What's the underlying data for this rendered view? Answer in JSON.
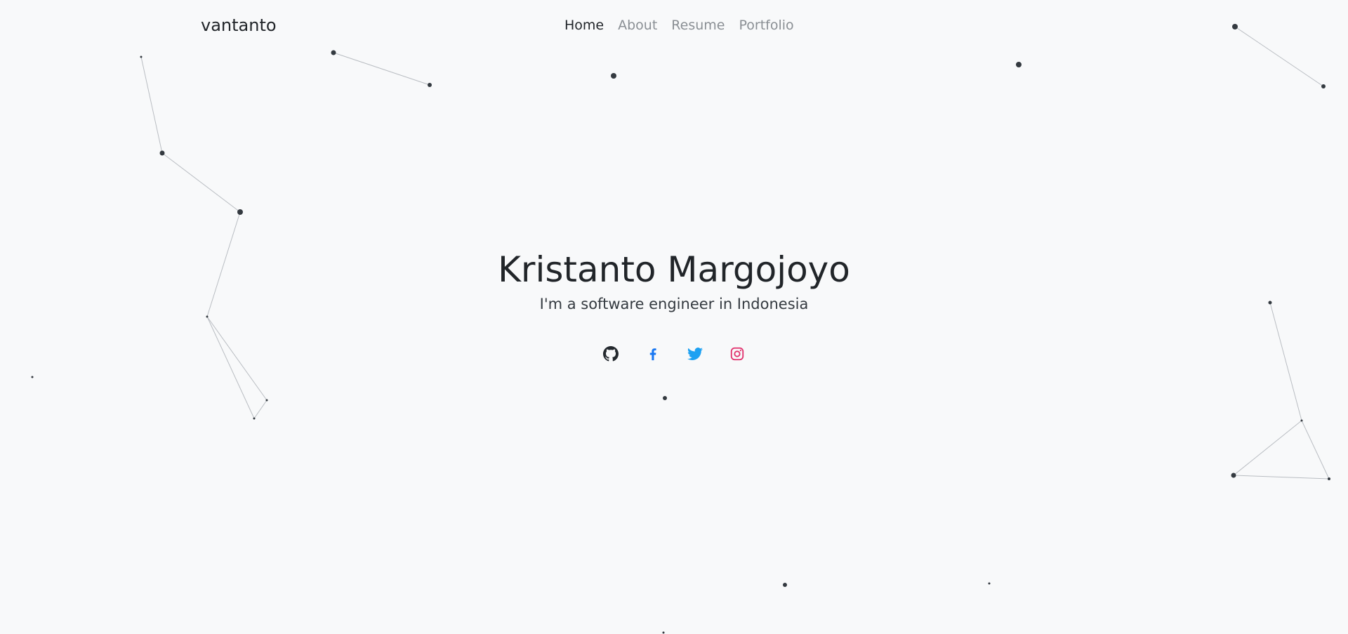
{
  "brand": {
    "name": "vantanto"
  },
  "nav": {
    "items": [
      {
        "label": "Home",
        "active": true
      },
      {
        "label": "About",
        "active": false
      },
      {
        "label": "Resume",
        "active": false
      },
      {
        "label": "Portfolio",
        "active": false
      }
    ]
  },
  "hero": {
    "name": "Kristanto Margojoyo",
    "tagline": "I'm a software engineer in Indonesia"
  },
  "socials": [
    {
      "icon": "github-icon",
      "color": "#24292e"
    },
    {
      "icon": "facebook-icon",
      "color": "#1877f2"
    },
    {
      "icon": "twitter-icon",
      "color": "#1da1f2"
    },
    {
      "icon": "instagram-icon",
      "color": "#e1306c"
    }
  ],
  "colors": {
    "background": "#f8f9fa",
    "text": "#212529",
    "nav_inactive": "#8a8f94",
    "particle": "#343a40",
    "particle_link": "#b9bdc2"
  }
}
